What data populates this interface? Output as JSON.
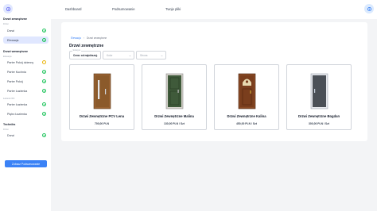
{
  "header": {
    "nav": [
      "Dashboard",
      "Podsumowanie",
      "Twoje pliki"
    ]
  },
  "sidebar": {
    "sections": [
      {
        "title": "Drzwi zewnętrzne",
        "sub": "Drzwi",
        "items": [
          {
            "label": "Drzwi",
            "status": "done",
            "active": false
          },
          {
            "label": "Elewacja",
            "status": "done",
            "active": true
          }
        ]
      },
      {
        "title": "Drzwi wewnętrzne",
        "sub": "Elewacja",
        "items": [
          {
            "label": "Parter Pokój dzienny",
            "status": "pending",
            "active": false
          },
          {
            "label": "Parter Kuchnia",
            "status": "done",
            "active": false
          },
          {
            "label": "Parter Pokój",
            "status": "done",
            "active": false
          },
          {
            "label": "Parter Łazienka",
            "status": "done",
            "active": false
          }
        ]
      },
      {
        "title": "",
        "sub": "Łazienki WC",
        "items": [
          {
            "label": "Parter Łazienka",
            "status": "done",
            "active": false
          },
          {
            "label": "Piętro Łazienka",
            "status": "done",
            "active": false
          }
        ]
      },
      {
        "title": "Techniks",
        "sub": "Drzwi",
        "items": [
          {
            "label": "Drzwi",
            "status": "done",
            "active": false
          }
        ]
      }
    ],
    "summary_button": "Zobacz Podsumowanie"
  },
  "main": {
    "breadcrumb": [
      "Elewacja",
      "Drzwi zewnętrzne"
    ],
    "title": "Drzwi zewnętrzne",
    "filters": [
      {
        "label": "Sortuj po",
        "value": "Cena: od najniższej"
      },
      {
        "label": "",
        "value": "Kolor"
      },
      {
        "label": "",
        "value": "Strona"
      }
    ],
    "products": [
      {
        "name": "Drzwi Zewnętrzne PCV Lena",
        "price": "700,00 PLN",
        "door_color": "#8b5a2b"
      },
      {
        "name": "Drzwi Zewnętrzne Malina",
        "price": "130,00 PLN / Szt",
        "door_color": "#3f5a3a"
      },
      {
        "name": "Drzwi Zewnętrzne Kalina",
        "price": "450,00 PLN / Szt",
        "door_color": "#7a3e1d"
      },
      {
        "name": "Drzwi Zewnętrzne Bogdan",
        "price": "300,00 PLN / Szt",
        "door_color": "#4b5057"
      }
    ]
  }
}
